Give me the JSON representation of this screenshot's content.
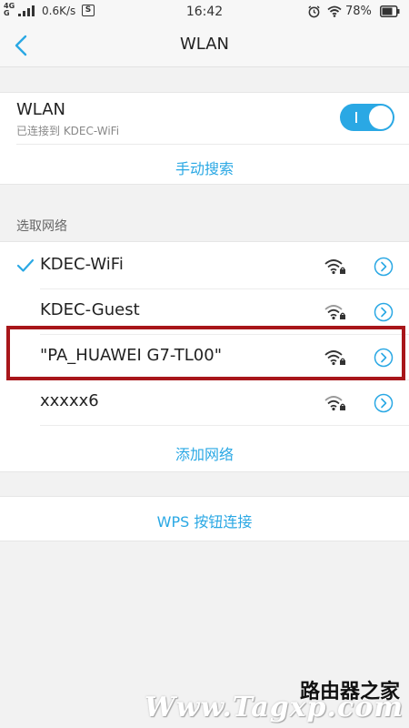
{
  "status_bar": {
    "network": "4G",
    "speed": "0.6K/s",
    "sim_label": "S",
    "time": "16:42",
    "battery": "78%"
  },
  "header": {
    "title": "WLAN",
    "back_icon": "chevron-left-icon"
  },
  "wlan": {
    "label": "WLAN",
    "status": "已连接到 KDEC-WiFi",
    "enabled": true,
    "manual_scan": "手动搜索"
  },
  "networks_section": {
    "label": "选取网络",
    "items": [
      {
        "name": "KDEC-WiFi",
        "connected": true
      },
      {
        "name": "KDEC-Guest",
        "connected": false
      },
      {
        "name": "\"PA_HUAWEI G7-TL00\"",
        "connected": false
      },
      {
        "name": "xxxxx6",
        "connected": false
      }
    ],
    "add_network": "添加网络"
  },
  "wps": {
    "label": "WPS 按钮连接"
  },
  "watermark": {
    "top": "路由器之家",
    "bottom": "Www.Tagxp.com"
  },
  "colors": {
    "accent": "#2aa8e4",
    "highlight": "#a8161a"
  }
}
